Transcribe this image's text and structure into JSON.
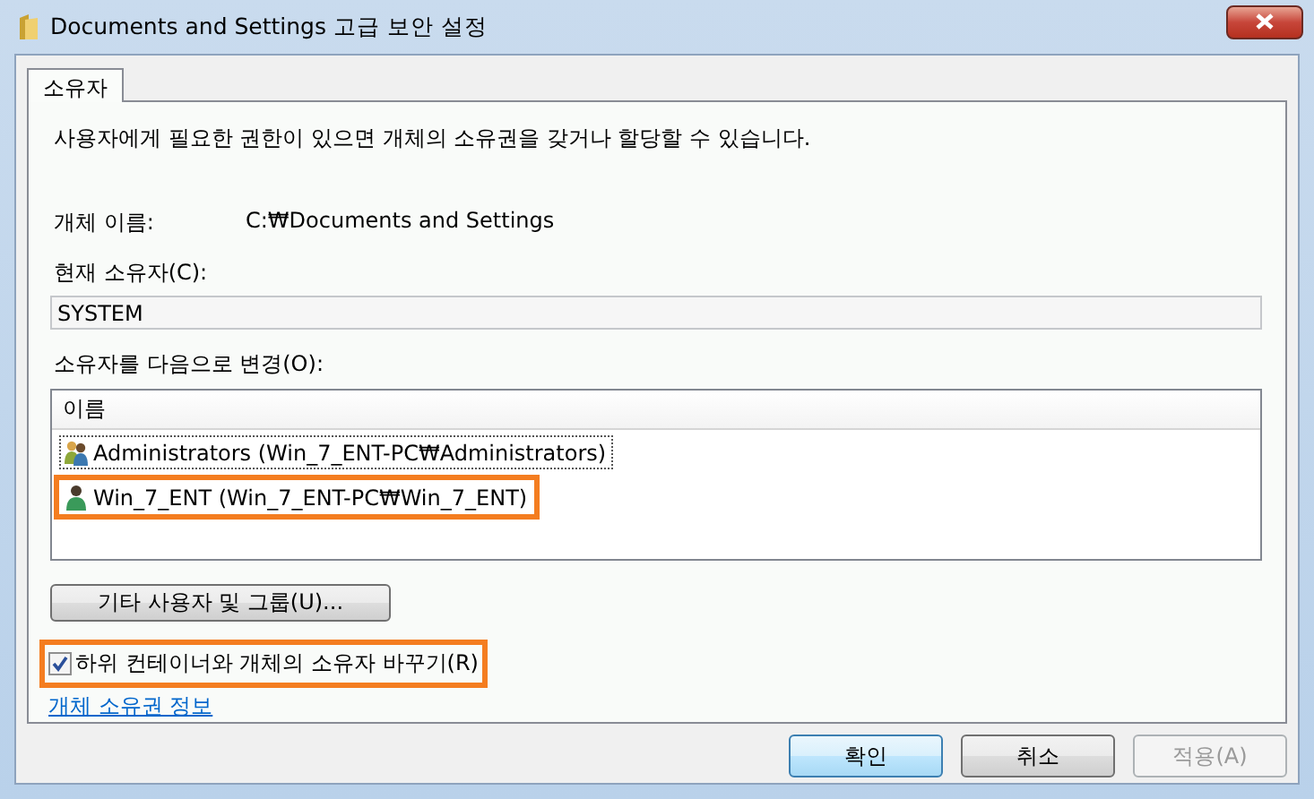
{
  "window": {
    "title": "Documents and Settings 고급 보안 설정"
  },
  "tabs": [
    {
      "label": "소유자",
      "selected": true
    }
  ],
  "description": "사용자에게 필요한 권한이 있으면 개체의 소유권을 갖거나 할당할 수 있습니다.",
  "object_name": {
    "label": "개체 이름:",
    "value": "C:₩Documents and Settings"
  },
  "current_owner": {
    "label": "현재 소유자(C):",
    "value": "SYSTEM"
  },
  "change_owner": {
    "label": "소유자를 다음으로 변경(O):",
    "column": "이름",
    "rows": [
      {
        "name": "Administrators (Win_7_ENT-PC₩Administrators)",
        "kind": "group",
        "focused": true,
        "highlighted": false
      },
      {
        "name": "Win_7_ENT (Win_7_ENT-PC₩Win_7_ENT)",
        "kind": "user",
        "focused": false,
        "highlighted": true
      }
    ]
  },
  "other_users_button": "기타 사용자 및 그룹(U)...",
  "replace_checkbox": {
    "label": "하위 컨테이너와 개체의 소유자 바꾸기(R)",
    "checked": true,
    "highlighted": true
  },
  "link": "개체 소유권 정보",
  "buttons": [
    {
      "label": "확인",
      "kind": "default",
      "disabled": false
    },
    {
      "label": "취소",
      "kind": "normal",
      "disabled": false
    },
    {
      "label": "적용(A)",
      "kind": "normal",
      "disabled": true
    }
  ]
}
